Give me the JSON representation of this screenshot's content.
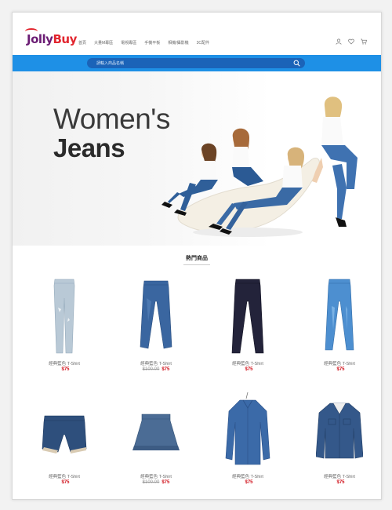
{
  "brand": {
    "logo_part1": "Jolly",
    "logo_part2": "Buy"
  },
  "nav": {
    "items": [
      "首頁",
      "大量M專區",
      "電視專區",
      "手機平板",
      "相機/攝影機",
      "3C配件"
    ]
  },
  "utility": {
    "icons": [
      "user-icon",
      "heart-icon",
      "cart-icon"
    ]
  },
  "search": {
    "placeholder": "請輸入商品名稱"
  },
  "hero": {
    "line1": "Women's",
    "line2": "Jeans"
  },
  "section": {
    "title": "熱門商品"
  },
  "products": [
    {
      "name": "經典藍色 T-Shirt",
      "old_price": "",
      "price": "$75",
      "image": "light-wash-jeans"
    },
    {
      "name": "經典藍色 T-Shirt",
      "old_price": "$100.00",
      "price": "$75",
      "image": "medium-wash-jeans"
    },
    {
      "name": "經典藍色 T-Shirt",
      "old_price": "",
      "price": "$75",
      "image": "dark-wash-jeans"
    },
    {
      "name": "經典藍色 T-Shirt",
      "old_price": "",
      "price": "$75",
      "image": "bright-blue-jeans"
    },
    {
      "name": "經典藍色 T-Shirt",
      "old_price": "",
      "price": "$75",
      "image": "denim-shorts"
    },
    {
      "name": "經典藍色 T-Shirt",
      "old_price": "$100.00",
      "price": "$75",
      "image": "denim-skirt"
    },
    {
      "name": "經典藍色 T-Shirt",
      "old_price": "",
      "price": "$75",
      "image": "denim-shirt"
    },
    {
      "name": "經典藍色 T-Shirt",
      "old_price": "",
      "price": "$75",
      "image": "denim-jacket"
    }
  ],
  "colors": {
    "searchbar": "#1e90e6",
    "search_field": "#1b63b8",
    "price": "#d0111b",
    "logo_purple": "#6b1d74",
    "logo_red": "#e2262f"
  }
}
